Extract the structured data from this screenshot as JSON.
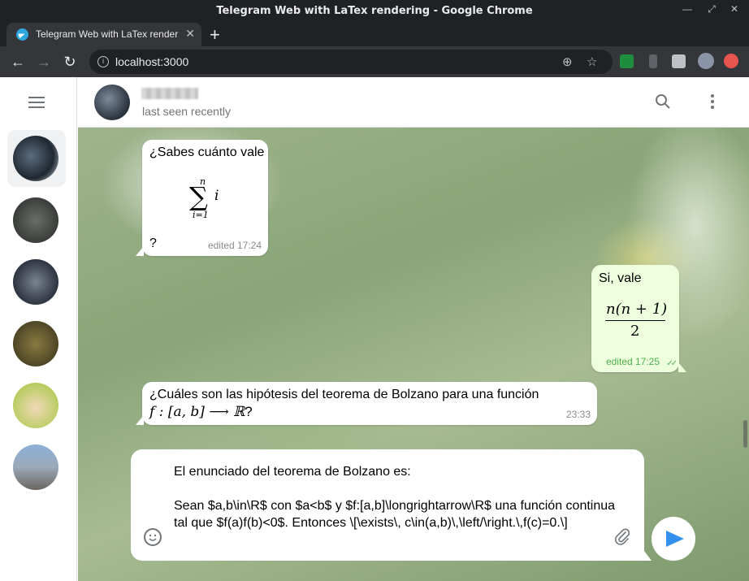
{
  "window": {
    "title": "Telegram Web with LaTex rendering - Google Chrome"
  },
  "tab": {
    "title": "Telegram Web with LaTex rendering",
    "close": "✕",
    "new_tab": "+"
  },
  "toolbar": {
    "url": "localhost:3000",
    "back": "←",
    "forward": "→",
    "reload": "↻"
  },
  "header": {
    "status": "last seen recently"
  },
  "messages": [
    {
      "direction": "in",
      "text_before": "¿Sabes cuánto vale",
      "math_upper": "n",
      "math_symbol": "∑",
      "math_var": "i",
      "math_lower": "i=1",
      "text_after": "?",
      "meta": "edited 17:24"
    },
    {
      "direction": "out",
      "text_before": "Si, vale",
      "math_numerator": "n(n + 1)",
      "math_denominator": "2",
      "meta": "edited 17:25",
      "check": "✓✓"
    },
    {
      "direction": "in",
      "text_before": "¿Cuáles son las hipótesis del teorema de Bolzano para una función",
      "math_inline": "f : [a, b] ⟶ ℝ",
      "text_after": "?",
      "meta": "23:33"
    }
  ],
  "composer": {
    "text": "El enunciado del teorema de Bolzano es:\n\nSean $a,b\\in\\R$ con $a<b$ y $f:[a,b]\\longrightarrow\\R$ una función continua tal que $f(a)f(b)<0$. Entonces \\[\\exists\\, c\\in(a,b)\\,\\left/\\right.\\,f(c)=0.\\]"
  },
  "colors": {
    "accent": "#3390ec",
    "outgoing_bubble": "#eeffde",
    "meta_out": "#4fae4e"
  },
  "icons": [
    "telegram-favicon",
    "menu-icon",
    "search-icon",
    "more-vertical-icon",
    "emoji-icon",
    "paperclip-icon",
    "send-icon"
  ]
}
